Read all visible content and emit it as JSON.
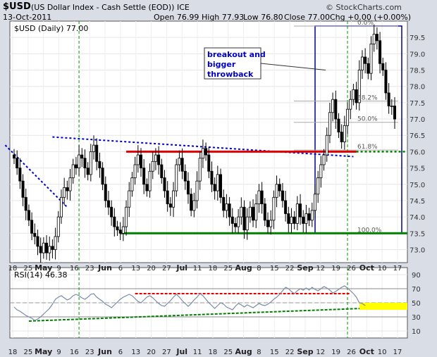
{
  "header": {
    "symbol": "$USD",
    "name": "(US Dollar Index - Cash Settle (EOD))",
    "exchange": "ICE",
    "date": "13-Oct-2011",
    "open": "Open 76.99",
    "high": "High 77.93",
    "low": "Low 76.80",
    "close": "Close 77.00",
    "chg": "Chg +0.00 (+0.00%)",
    "copyright": "© StockCharts.com",
    "legend_price": "$USD (Daily) 77.00",
    "legend_rsi": "RSI(14) 46.38"
  },
  "annotation": {
    "lines": [
      "breakout and",
      "bigger",
      "throwback"
    ]
  },
  "colors": {
    "background": "#d9dde6",
    "panel": "#ffffff",
    "resistance": "#e00000",
    "support": "#008000",
    "trend": "#0000cc",
    "highlight": "#ffff00",
    "rsi_line": "#7a8aa8"
  },
  "chart_data": [
    {
      "type": "ohlc",
      "title": "$USD (Daily) 77.00",
      "ylim": [
        72.6,
        80.0
      ],
      "y_ticks": [
        73.0,
        73.5,
        74.0,
        74.5,
        75.0,
        75.5,
        76.0,
        76.5,
        77.0,
        77.5,
        78.0,
        78.5,
        79.0,
        79.5
      ],
      "x_tick_labels": [
        "18",
        "25",
        "May",
        "9",
        "16",
        "23",
        "Jun",
        "6",
        "13",
        "20",
        "27",
        "Jul",
        "11",
        "18",
        "25",
        "Aug",
        "8",
        "15",
        "22",
        "Sep",
        "12",
        "19",
        "26",
        "Oct",
        "10",
        "17"
      ],
      "closes": [
        75.8,
        75.5,
        75.1,
        74.6,
        74.2,
        73.9,
        73.5,
        73.4,
        73.1,
        72.9,
        73.2,
        72.9,
        73.1,
        73.0,
        73.4,
        74.0,
        74.6,
        74.9,
        74.8,
        75.2,
        75.6,
        75.5,
        75.9,
        75.8,
        75.5,
        75.3,
        76.0,
        76.2,
        75.7,
        75.5,
        75.0,
        74.5,
        74.3,
        74.0,
        73.7,
        73.6,
        73.5,
        73.7,
        74.3,
        74.8,
        75.2,
        75.6,
        75.9,
        75.5,
        75.0,
        74.8,
        75.4,
        75.7,
        75.9,
        75.6,
        75.2,
        74.8,
        74.4,
        74.3,
        74.8,
        75.6,
        75.8,
        75.4,
        75.1,
        74.7,
        74.2,
        74.5,
        75.1,
        75.8,
        76.1,
        75.9,
        75.4,
        75.0,
        74.8,
        75.3,
        74.6,
        74.2,
        74.4,
        74.0,
        73.8,
        73.7,
        74.0,
        74.3,
        73.6,
        74.0,
        74.3,
        73.9,
        74.4,
        74.8,
        74.4,
        73.9,
        73.7,
        73.9,
        74.6,
        75.0,
        74.8,
        74.5,
        74.1,
        73.8,
        74.0,
        73.8,
        74.4,
        74.0,
        73.8,
        74.1,
        73.9,
        74.2,
        74.7,
        75.2,
        75.6,
        75.9,
        76.5,
        77.2,
        77.6,
        77.0,
        76.6,
        76.3,
        76.8,
        77.3,
        77.6,
        77.9,
        77.5,
        78.5,
        78.9,
        78.7,
        78.4,
        79.3,
        79.6,
        79.4,
        78.7,
        78.5,
        77.8,
        77.4,
        77.4,
        77.0
      ],
      "fib_retracements": [
        {
          "label": "0.0%",
          "value": 79.85
        },
        {
          "label": "38.2%",
          "value": 77.55
        },
        {
          "label": "50.0%",
          "value": 76.9
        },
        {
          "label": "61.8%",
          "value": 76.05
        },
        {
          "label": "100.0%",
          "value": 73.5
        }
      ],
      "resistance_level": 76.0,
      "support_level": 73.5
    },
    {
      "type": "line",
      "title": "RSI(14) 46.38",
      "ylim": [
        0,
        100
      ],
      "y_ticks": [
        10,
        30,
        50,
        70,
        90
      ],
      "series": [
        {
          "name": "RSI(14)",
          "values": [
            44,
            40,
            38,
            35,
            32,
            30,
            28,
            25,
            27,
            30,
            34,
            38,
            42,
            48,
            55,
            58,
            60,
            57,
            54,
            56,
            60,
            62,
            60,
            57,
            55,
            58,
            62,
            63,
            58,
            55,
            52,
            48,
            46,
            43,
            47,
            51,
            55,
            58,
            60,
            62,
            60,
            56,
            52,
            50,
            54,
            58,
            60,
            57,
            53,
            49,
            46,
            45,
            49,
            53,
            58,
            62,
            58,
            53,
            49,
            45,
            49,
            54,
            58,
            63,
            60,
            55,
            50,
            46,
            42,
            46,
            50,
            48,
            44,
            42,
            40,
            45,
            49,
            47,
            44,
            47,
            45,
            43,
            46,
            49,
            47,
            46,
            48,
            51,
            55,
            58,
            62,
            67,
            72,
            70,
            66,
            63,
            67,
            70,
            68,
            71,
            68,
            72,
            69,
            67,
            70,
            73,
            71,
            68,
            64,
            66,
            69,
            72,
            74,
            71,
            67,
            63,
            58,
            50,
            49,
            46
          ]
        }
      ]
    }
  ]
}
